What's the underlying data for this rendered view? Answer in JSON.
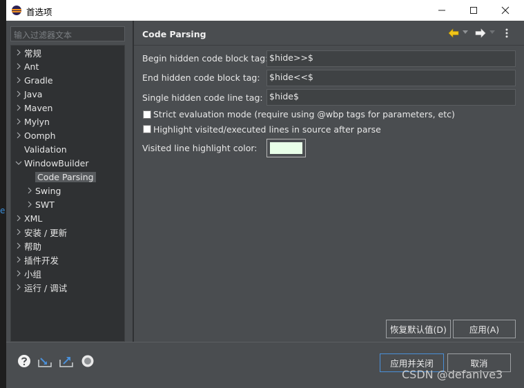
{
  "window": {
    "title": "首选项"
  },
  "filter": {
    "placeholder": "输入过滤器文本"
  },
  "tree": {
    "items": [
      {
        "label": "常规",
        "expandable": true
      },
      {
        "label": "Ant",
        "expandable": true
      },
      {
        "label": "Gradle",
        "expandable": true
      },
      {
        "label": "Java",
        "expandable": true
      },
      {
        "label": "Maven",
        "expandable": true
      },
      {
        "label": "Mylyn",
        "expandable": true
      },
      {
        "label": "Oomph",
        "expandable": true
      },
      {
        "label": "Validation",
        "expandable": false
      },
      {
        "label": "WindowBuilder",
        "expandable": true,
        "expanded": true
      },
      {
        "label": "Code Parsing",
        "expandable": false,
        "selected": true
      },
      {
        "label": "Swing",
        "expandable": true
      },
      {
        "label": "SWT",
        "expandable": true
      },
      {
        "label": "XML",
        "expandable": true
      },
      {
        "label": "安装 / 更新",
        "expandable": true
      },
      {
        "label": "帮助",
        "expandable": true
      },
      {
        "label": "插件开发",
        "expandable": true
      },
      {
        "label": "小组",
        "expandable": true
      },
      {
        "label": "运行 / 调试",
        "expandable": true
      }
    ]
  },
  "page": {
    "title": "Code Parsing",
    "fields": {
      "begin_label": "Begin hidden code block tag:",
      "begin_value": "$hide>>$",
      "end_label": "End hidden code block tag:",
      "end_value": "$hide<<$",
      "single_label": "Single hidden code line tag:",
      "single_value": "$hide$"
    },
    "checkboxes": {
      "strict_label": "Strict evaluation mode (require using @wbp tags for parameters, etc)",
      "strict_checked": false,
      "highlight_label": "Highlight visited/executed lines in source after parse",
      "highlight_checked": false
    },
    "color": {
      "label": "Visited line highlight color:",
      "value": "#e8ffe8"
    },
    "buttons": {
      "restore": "恢复默认值(D)",
      "apply": "应用(A)"
    }
  },
  "footer": {
    "apply_close": "应用并关闭",
    "cancel": "取消"
  },
  "watermark": "CSDN @defanive3",
  "colors": {
    "accent_back_arrow": "#f0c419",
    "focus_border": "#4a90d9"
  }
}
